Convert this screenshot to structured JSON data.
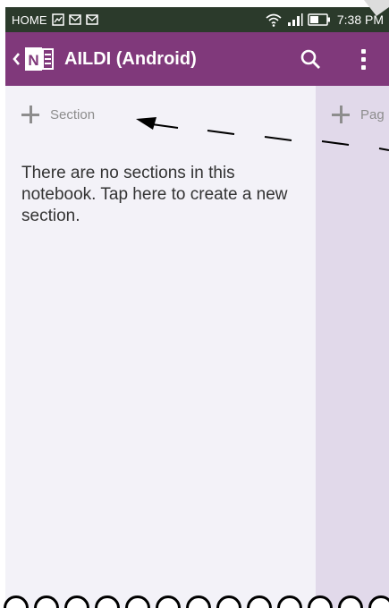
{
  "status_bar": {
    "carrier": "HOME",
    "time": "7:38 PM",
    "left_icons": [
      "image-icon",
      "mail-icon",
      "mail-icon"
    ],
    "right_icons": [
      "wifi-icon",
      "signal-icon",
      "battery-icon"
    ]
  },
  "app_bar": {
    "title": "AILDI (Android)",
    "color": "#80397b",
    "icons": [
      "back-icon",
      "onenote-logo-icon",
      "search-icon",
      "more-vert-icon"
    ]
  },
  "sections_pane": {
    "add_label": "Section",
    "empty_message": "There are no sections in this notebook. Tap here to create a new section."
  },
  "pages_pane": {
    "add_label": "Pag"
  }
}
